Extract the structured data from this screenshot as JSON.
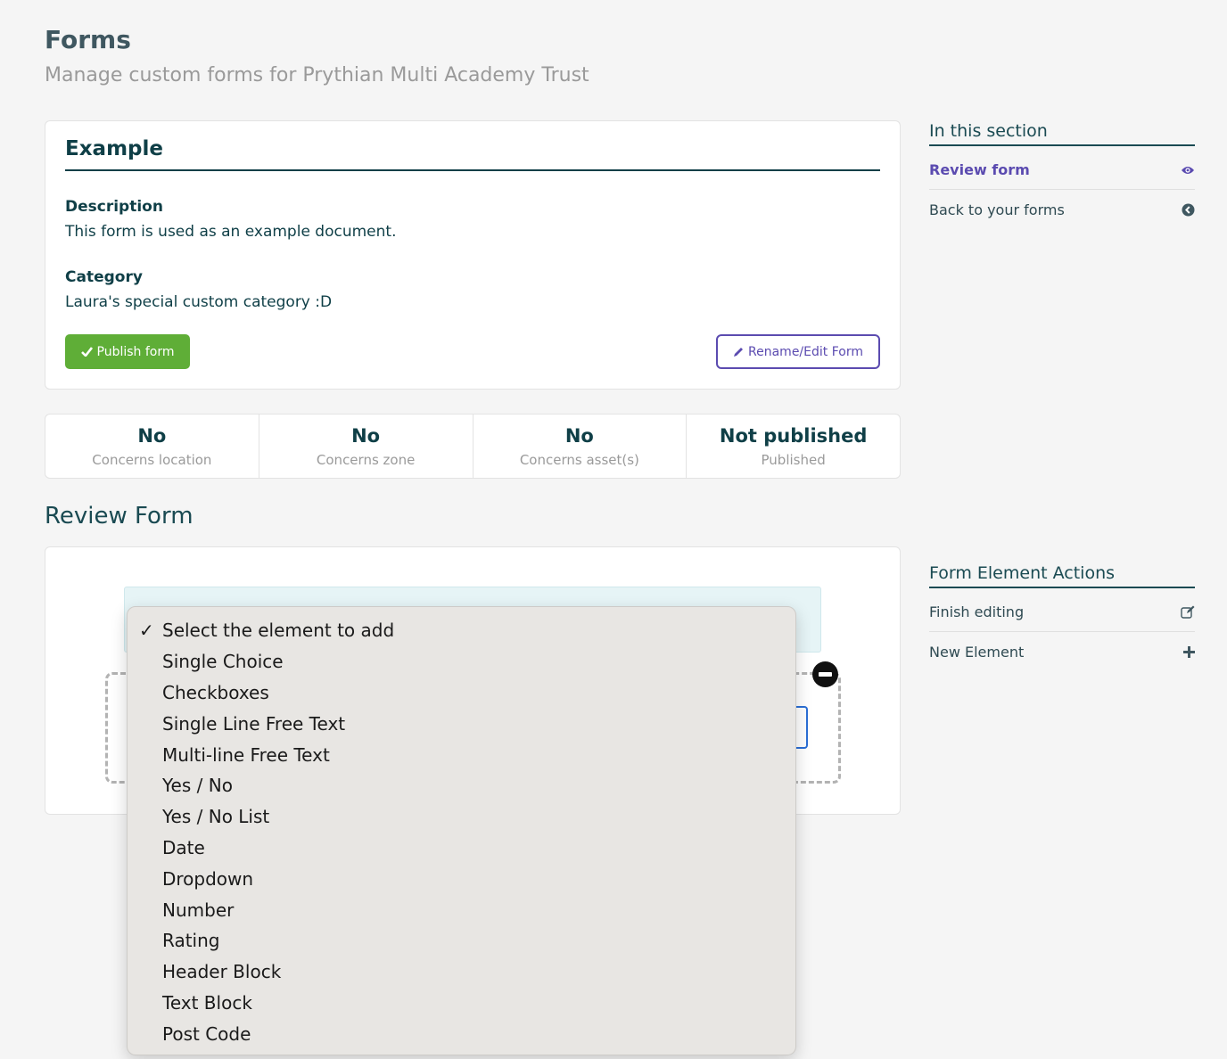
{
  "page": {
    "title": "Forms",
    "subtitle": "Manage custom forms for Prythian Multi Academy Trust"
  },
  "form": {
    "name": "Example",
    "description_label": "Description",
    "description": "This form is used as an example document.",
    "category_label": "Category",
    "category": "Laura's special custom category :D",
    "publish_label": "Publish form",
    "rename_label": "Rename/Edit Form"
  },
  "stats": [
    {
      "value": "No",
      "label": "Concerns location"
    },
    {
      "value": "No",
      "label": "Concerns zone"
    },
    {
      "value": "No",
      "label": "Concerns asset(s)"
    },
    {
      "value": "Not published",
      "label": "Published"
    }
  ],
  "review": {
    "heading": "Review Form"
  },
  "dropdown": {
    "options": [
      "Select the element to add",
      "Single Choice",
      "Checkboxes",
      "Single Line Free Text",
      "Multi-line Free Text",
      "Yes / No",
      "Yes / No List",
      "Date",
      "Dropdown",
      "Number",
      "Rating",
      "Header Block",
      "Text Block",
      "Post Code"
    ],
    "selected": "Select the element to add"
  },
  "sidebar": {
    "section_heading": "In this section",
    "items": [
      {
        "label": "Review form",
        "icon": "eye-icon"
      },
      {
        "label": "Back to your forms",
        "icon": "back-circle-icon"
      }
    ],
    "actions_heading": "Form Element Actions",
    "actions": [
      {
        "label": "Finish editing",
        "icon": "edit-icon"
      },
      {
        "label": "New Element",
        "icon": "plus-icon"
      }
    ]
  },
  "colors": {
    "publish_green": "#5fae37",
    "accent_purple": "#5b4bb0",
    "heading_teal": "#0f3f47"
  }
}
